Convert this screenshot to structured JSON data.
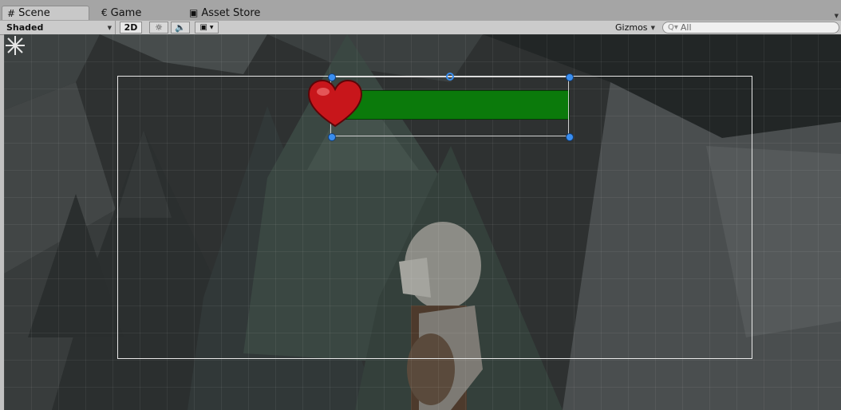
{
  "tabs": [
    {
      "label": "Scene",
      "icon": "grid-hash-icon",
      "glyph": "#"
    },
    {
      "label": "Game",
      "icon": "game-controller-icon",
      "glyph": "€"
    },
    {
      "label": "Asset Store",
      "icon": "shopping-bag-icon",
      "glyph": "▣"
    }
  ],
  "toolbar": {
    "shading_mode": "Shaded",
    "mode_2d_label": "2D",
    "gizmos_label": "Gizmos",
    "search_prefix": "Q▾",
    "search_value": "All"
  },
  "scene": {
    "health_bar_fill_fraction": 1.0,
    "health_bar_color": "#0b7a0b",
    "heart_color": "#c8161b",
    "handle_color": "#3a8eef"
  }
}
